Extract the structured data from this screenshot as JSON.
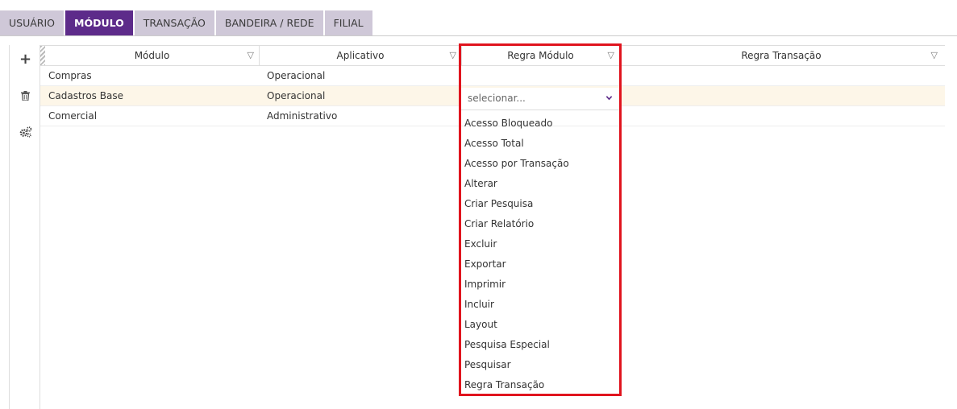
{
  "tabs": [
    {
      "label": "USUÁRIO",
      "active": false
    },
    {
      "label": "MÓDULO",
      "active": true
    },
    {
      "label": "TRANSAÇÃO",
      "active": false
    },
    {
      "label": "BANDEIRA / REDE",
      "active": false
    },
    {
      "label": "FILIAL",
      "active": false
    }
  ],
  "toolbar": {
    "add_icon": "plus-icon",
    "delete_icon": "trash-icon",
    "settings_icon": "gears-icon"
  },
  "grid": {
    "columns": [
      "Módulo",
      "Aplicativo",
      "Regra Módulo",
      "Regra Transação"
    ],
    "filter_icon": "filter-icon",
    "rows": [
      {
        "modulo": "Compras",
        "aplicativo": "Operacional",
        "regra_modulo": "",
        "regra_transacao": ""
      },
      {
        "modulo": "Cadastros Base",
        "aplicativo": "Operacional",
        "regra_modulo": "",
        "regra_transacao": ""
      },
      {
        "modulo": "Comercial",
        "aplicativo": "Administrativo",
        "regra_modulo": "",
        "regra_transacao": ""
      }
    ],
    "selected_row": 1
  },
  "dropdown": {
    "placeholder": "selecionar...",
    "options": [
      "Acesso Bloqueado",
      "Acesso Total",
      "Acesso por Transação",
      "Alterar",
      "Criar Pesquisa",
      "Criar Relatório",
      "Excluir",
      "Exportar",
      "Imprimir",
      "Incluir",
      "Layout",
      "Pesquisa Especial",
      "Pesquisar",
      "Regra Transação"
    ]
  },
  "colors": {
    "tab_active": "#5d2b8a",
    "tab_inactive": "#cfc8d8",
    "highlight": "#e0141e",
    "selected_row": "#fdf6e8",
    "chevron": "#5d2b8a"
  }
}
